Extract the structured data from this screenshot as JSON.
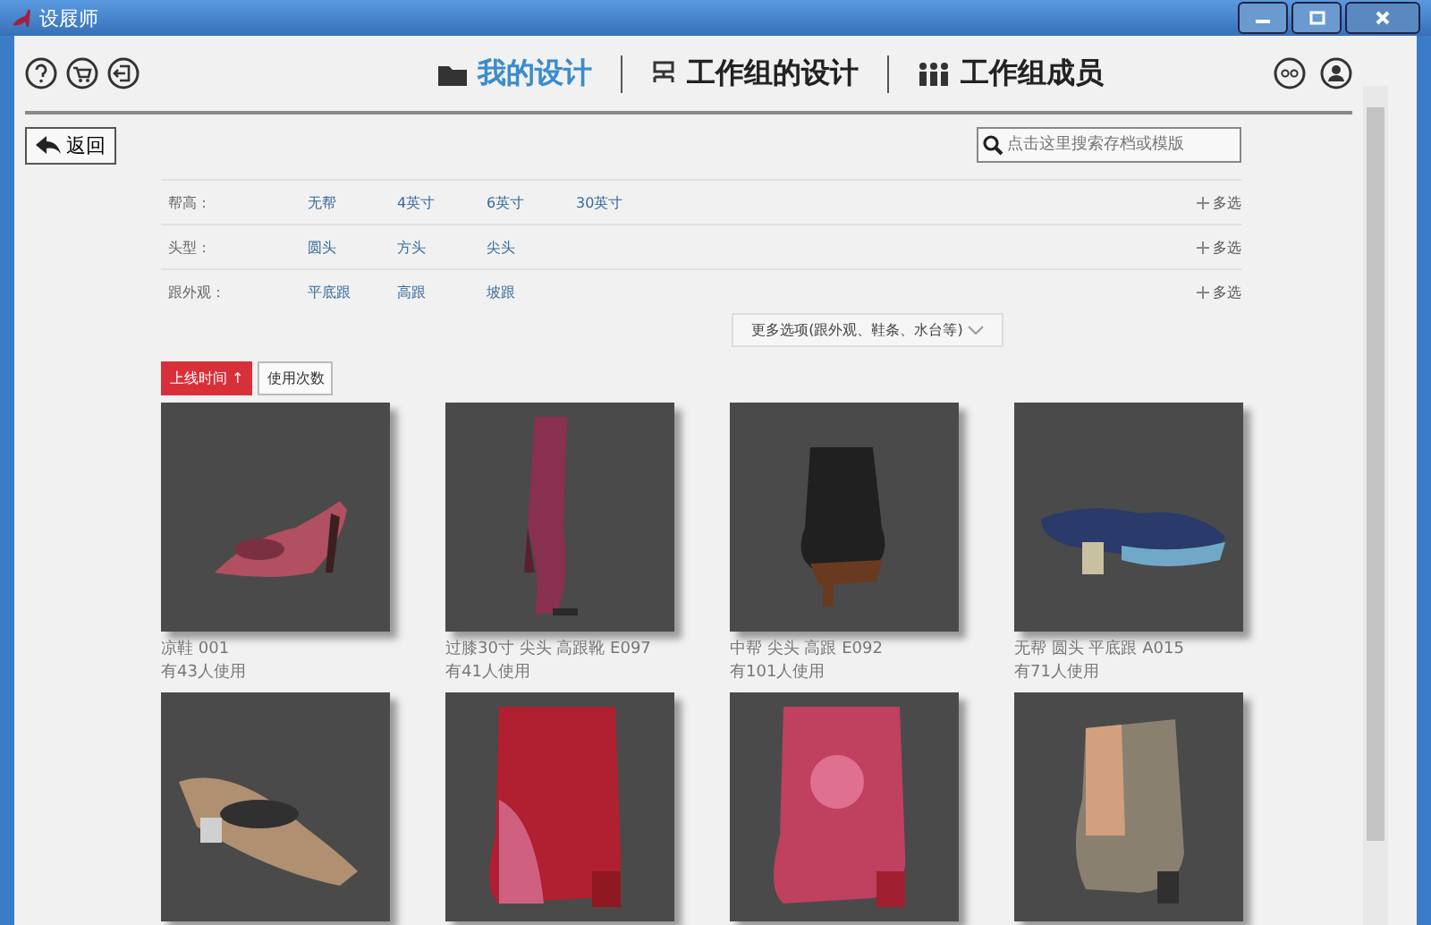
{
  "window": {
    "title": "设屐师"
  },
  "tabs": [
    {
      "label": "我的设计",
      "selected": true
    },
    {
      "label": "工作组的设计",
      "selected": false
    },
    {
      "label": "工作组成员",
      "selected": false
    }
  ],
  "back_button": "返回",
  "search": {
    "placeholder": "点击这里搜索存档或模版"
  },
  "filters": [
    {
      "label": "帮高：",
      "options": [
        "无帮",
        "4英寸",
        "6英寸",
        "30英寸"
      ],
      "multi": "多选"
    },
    {
      "label": "头型：",
      "options": [
        "圆头",
        "方头",
        "尖头"
      ],
      "multi": "多选"
    },
    {
      "label": "跟外观：",
      "options": [
        "平底跟",
        "高跟",
        "坡跟"
      ],
      "multi": "多选"
    }
  ],
  "more_options": "更多选项(跟外观、鞋条、水台等)",
  "sort": [
    {
      "label": "上线时间 ↑",
      "selected": true
    },
    {
      "label": "使用次数",
      "selected": false
    }
  ],
  "designs": [
    {
      "name": "凉鞋 001",
      "usage": "有43人使用",
      "kind": "pump"
    },
    {
      "name": "过膝30寸 尖头 高跟靴 E097",
      "usage": "有41人使用",
      "kind": "tallboot"
    },
    {
      "name": "中帮 尖头 高跟 E092",
      "usage": "有101人使用",
      "kind": "bootie"
    },
    {
      "name": "无帮 圆头 平底跟 A015",
      "usage": "有71人使用",
      "kind": "flat"
    },
    {
      "kind": "flat2"
    },
    {
      "kind": "ankle"
    },
    {
      "kind": "ankle2"
    },
    {
      "kind": "bootie2"
    }
  ]
}
